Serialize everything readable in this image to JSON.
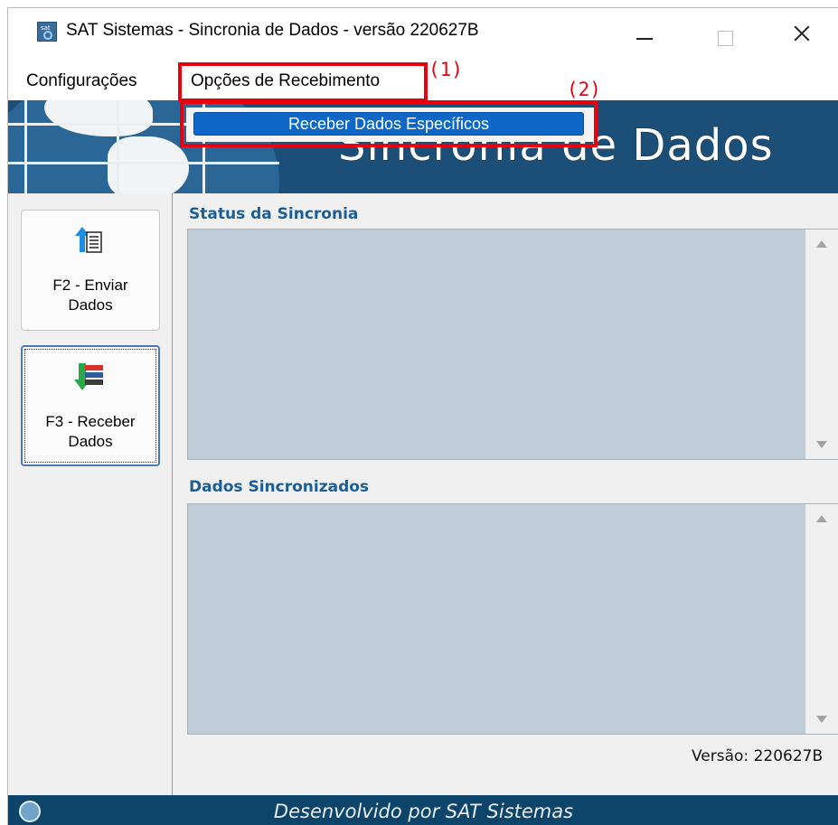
{
  "window": {
    "title": "SAT Sistemas - Sincronia de Dados - versão 220627B",
    "icon_text": "sat"
  },
  "menubar": {
    "items": [
      "Configurações",
      "Opções de Recebimento"
    ]
  },
  "dropdown": {
    "items": [
      "Receber Dados Específicos"
    ]
  },
  "annotations": {
    "label_1": "(1)",
    "label_2": "(2)",
    "color": "#e8000e"
  },
  "banner": {
    "title": "Sincronia de Dados"
  },
  "side_buttons": [
    {
      "label": "F2 - Enviar\nDados",
      "icon": "upload-list-icon"
    },
    {
      "label": "F3 - Receber\nDados",
      "icon": "download-stack-icon"
    }
  ],
  "sections": {
    "status_title": "Status da Sincronia",
    "synced_title": "Dados Sincronizados"
  },
  "version_text": "Versão: 220627B",
  "footer": {
    "text": "Desenvolvido por SAT Sistemas"
  },
  "colors": {
    "accent": "#1c5e93",
    "highlight": "#0e67c6",
    "banner": "#1c4f77",
    "footer": "#0d4469",
    "listbox": "#c0ccd8"
  }
}
